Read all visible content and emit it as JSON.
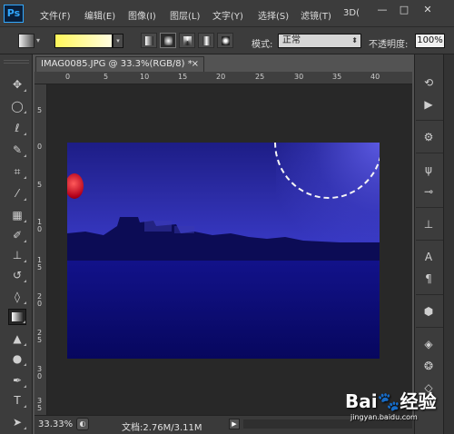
{
  "app": {
    "logo": "Ps"
  },
  "menu": [
    "文件(F)",
    "编辑(E)",
    "图像(I)",
    "图层(L)",
    "文字(Y)",
    "选择(S)",
    "滤镜(T)",
    "3D("
  ],
  "window_controls": {
    "minimize": "—",
    "maximize": "□",
    "close": "✕"
  },
  "options": {
    "gradient_preview_colors": [
      "#fff75a",
      "#fffde0"
    ],
    "mode_label": "模式:",
    "mode_value": "正常",
    "opacity_label": "不透明度:",
    "opacity_value": "100%",
    "active_gradient_type": "radial"
  },
  "document": {
    "tab_title": "IMAG0085.JPG @ 33.3%(RGB/8) *",
    "tab_close": "×",
    "ruler_top": [
      "0",
      "5",
      "10",
      "15",
      "20",
      "25",
      "30",
      "35",
      "40"
    ],
    "ruler_left": [
      "5",
      "0",
      "5",
      "1 0",
      "1 5",
      "2 0",
      "2 5",
      "3 0",
      "3 5"
    ]
  },
  "status": {
    "zoom": "33.33%",
    "doc_size": "文档:2.76M/3.11M"
  },
  "tools_left": [
    "move-tool-icon",
    "elliptical-marquee-icon",
    "lasso-icon",
    "quick-selection-icon",
    "crop-icon",
    "eyedropper-icon",
    "healing-brush-icon",
    "brush-icon",
    "clone-stamp-icon",
    "history-brush-icon",
    "eraser-icon",
    "gradient-icon",
    "blur-icon",
    "dodge-icon",
    "pen-icon",
    "type-icon",
    "path-selection-icon"
  ],
  "panels_right": [
    "history-panel-icon",
    "actions-panel-icon",
    "properties-panel-icon",
    "brush-panel-icon",
    "adjustments-panel-icon",
    "clone-source-icon",
    "character-panel-icon",
    "paragraph-panel-icon",
    "3d-panel-icon",
    "layers-panel-icon",
    "channels-panel-icon",
    "paths-panel-icon"
  ],
  "watermark": {
    "logo": "Bai🐾经验",
    "sub": "jingyan.baidu.com"
  }
}
